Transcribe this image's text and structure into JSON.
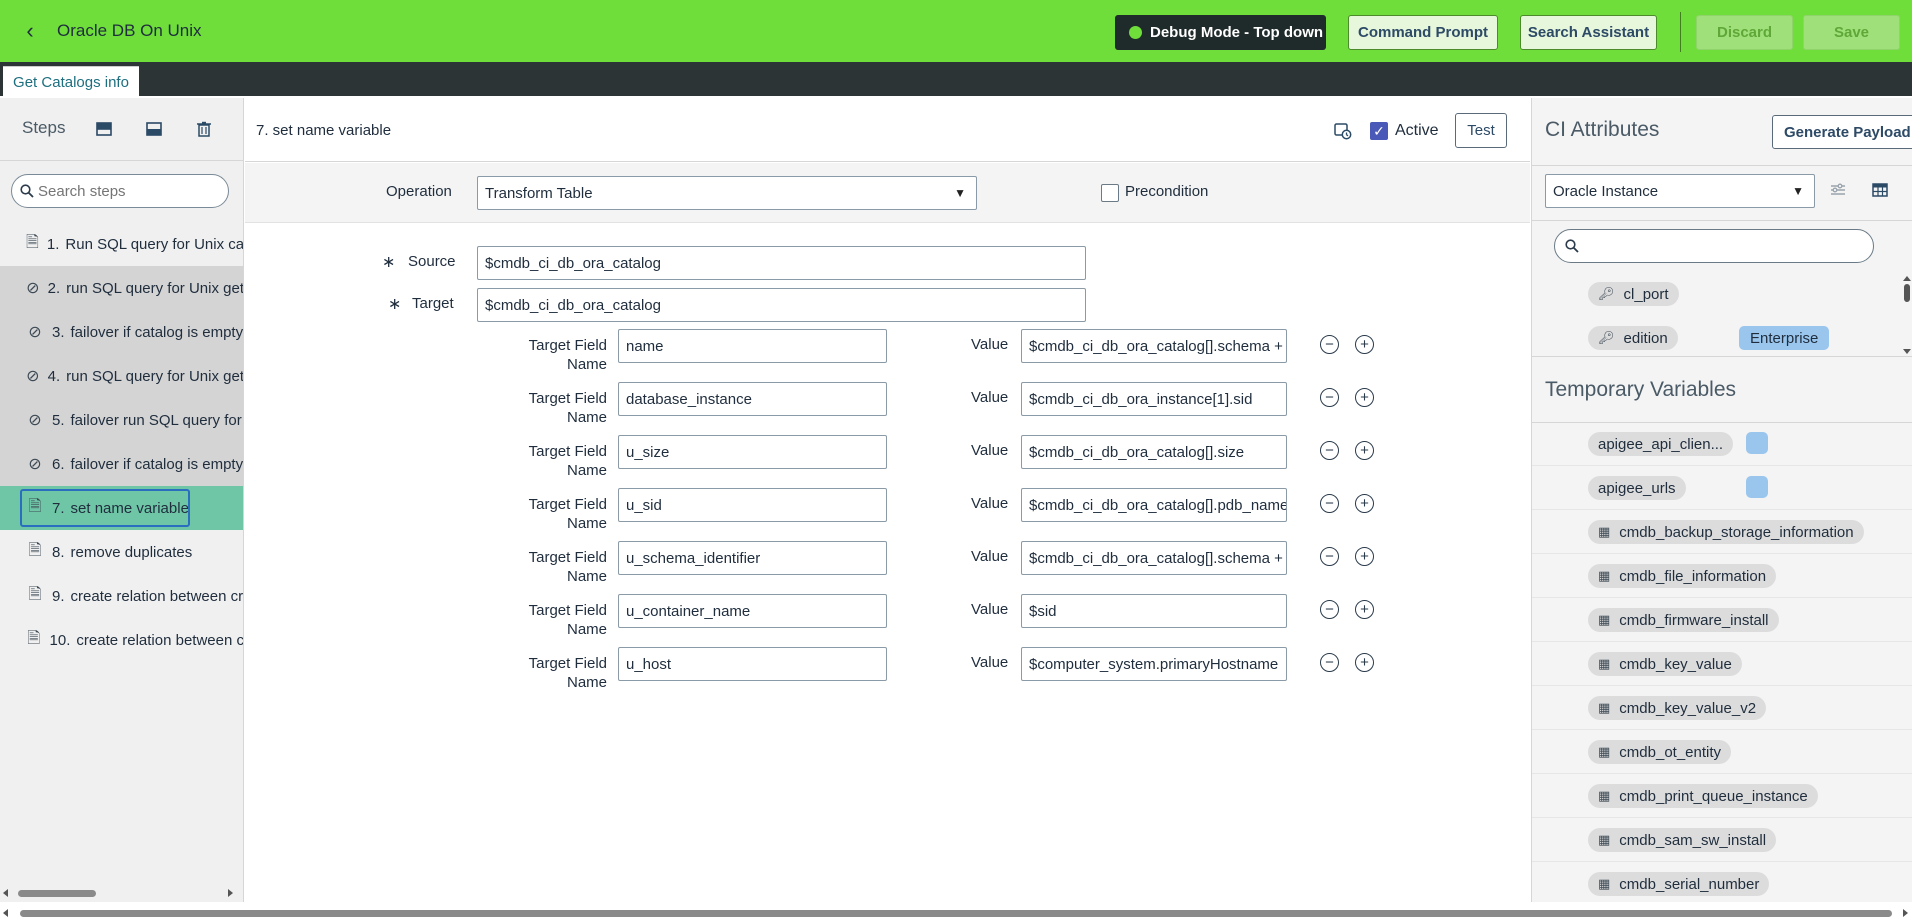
{
  "header": {
    "title": "Oracle DB On Unix",
    "debug_label": "Debug Mode - Top down",
    "command_prompt": "Command Prompt",
    "search_assistant": "Search Assistant",
    "discard": "Discard",
    "save": "Save"
  },
  "tabs": [
    {
      "label": "Get Catalogs info"
    }
  ],
  "steps_panel": {
    "title": "Steps",
    "search_placeholder": "Search steps",
    "items": [
      {
        "num": "1.",
        "label": "Run SQL query for Unix catalog",
        "state": "normal"
      },
      {
        "num": "2.",
        "label": "run SQL query for Unix get",
        "state": "disabled"
      },
      {
        "num": "3.",
        "label": "failover if catalog is empty",
        "state": "disabled"
      },
      {
        "num": "4.",
        "label": "run SQL query for Unix get",
        "state": "disabled"
      },
      {
        "num": "5.",
        "label": "failover run SQL query for",
        "state": "disabled"
      },
      {
        "num": "6.",
        "label": "failover if catalog is empty",
        "state": "disabled"
      },
      {
        "num": "7.",
        "label": "set name variable",
        "state": "selected"
      },
      {
        "num": "8.",
        "label": "remove duplicates",
        "state": "normal"
      },
      {
        "num": "9.",
        "label": "create relation between cr",
        "state": "normal"
      },
      {
        "num": "10.",
        "label": "create relation between c",
        "state": "normal"
      }
    ]
  },
  "step_editor": {
    "title": "7. set name variable",
    "active_label": "Active",
    "test_label": "Test",
    "operation_label": "Operation",
    "operation_value": "Transform Table",
    "precondition_label": "Precondition",
    "source_label": "Source",
    "source_value": "$cmdb_ci_db_ora_catalog",
    "target_label": "Target",
    "target_value": "$cmdb_ci_db_ora_catalog",
    "target_field_label": "Target Field Name",
    "value_label": "Value",
    "mappings": [
      {
        "field": "name",
        "value": "$cmdb_ci_db_ora_catalog[].schema + \"("
      },
      {
        "field": "database_instance",
        "value": "$cmdb_ci_db_ora_instance[1].sid"
      },
      {
        "field": "u_size",
        "value": "$cmdb_ci_db_ora_catalog[].size"
      },
      {
        "field": "u_sid",
        "value": "$cmdb_ci_db_ora_catalog[].pdb_name"
      },
      {
        "field": "u_schema_identifier",
        "value": "$cmdb_ci_db_ora_catalog[].schema + \"("
      },
      {
        "field": "u_container_name",
        "value": "$sid"
      },
      {
        "field": "u_host",
        "value": "$computer_system.primaryHostname"
      }
    ]
  },
  "ci_attributes": {
    "title": "CI Attributes",
    "generate_payload": "Generate Payload",
    "ci_type": "Oracle Instance",
    "items": [
      {
        "name": "cl_port",
        "value": ""
      },
      {
        "name": "edition",
        "value": "Enterprise"
      }
    ]
  },
  "temporary_variables": {
    "title": "Temporary Variables",
    "items": [
      {
        "name": "apigee_api_clien...",
        "kind": "variable"
      },
      {
        "name": "apigee_urls",
        "kind": "variable"
      },
      {
        "name": "cmdb_backup_storage_information",
        "kind": "table"
      },
      {
        "name": "cmdb_file_information",
        "kind": "table"
      },
      {
        "name": "cmdb_firmware_install",
        "kind": "table"
      },
      {
        "name": "cmdb_key_value",
        "kind": "table"
      },
      {
        "name": "cmdb_key_value_v2",
        "kind": "table"
      },
      {
        "name": "cmdb_ot_entity",
        "kind": "table"
      },
      {
        "name": "cmdb_print_queue_instance",
        "kind": "table"
      },
      {
        "name": "cmdb_sam_sw_install",
        "kind": "table"
      },
      {
        "name": "cmdb_serial_number",
        "kind": "table"
      }
    ]
  }
}
